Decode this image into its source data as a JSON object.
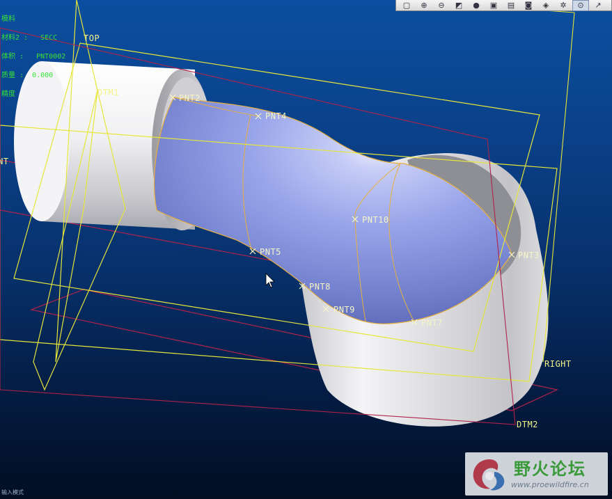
{
  "app": {
    "name": "Pro/ENGINEER Wildfire",
    "view": "3D model view"
  },
  "toolbar": {
    "buttons": [
      {
        "name": "refit-icon",
        "glyph": "▢"
      },
      {
        "name": "zoom-in-icon",
        "glyph": "⊕"
      },
      {
        "name": "zoom-out-icon",
        "glyph": "⊖"
      },
      {
        "name": "repaint-icon",
        "glyph": "◩"
      },
      {
        "name": "shading-icon",
        "glyph": "●"
      },
      {
        "name": "saved-views-icon",
        "glyph": "▣"
      },
      {
        "name": "view-manager-icon",
        "glyph": "▤"
      },
      {
        "name": "screenshot-icon",
        "glyph": "◙"
      },
      {
        "name": "orient-icon",
        "glyph": "◈"
      },
      {
        "name": "spin-center-icon",
        "glyph": "✲"
      },
      {
        "name": "datum-display-icon",
        "glyph": "⊙"
      },
      {
        "name": "extra-tool-icon",
        "glyph": "↗"
      }
    ]
  },
  "info_panel": {
    "lines": [
      "模料",
      "材料2 :   SECC",
      "体积 :   PNT0002",
      "质量 :  0.000",
      "精度"
    ]
  },
  "datum_planes": {
    "top": "TOP",
    "dtm1": "DTM1",
    "right": "RIGHT",
    "dtm2": "DTM2",
    "front": "FRONT"
  },
  "datum_points": {
    "pnt2": "PNT2",
    "pnt3": "PNT3",
    "pnt4": "PNT4",
    "pnt5": "PNT5",
    "pnt7": "PNT7",
    "pnt8": "PNT8",
    "pnt9": "PNT9",
    "pnt10": "PNT10"
  },
  "status_line": "输入模式",
  "watermark": {
    "title": "野火论坛",
    "url": "www.proewildfire.cn"
  },
  "colors": {
    "background_top": "#0b4fa0",
    "background_bottom": "#020d22",
    "datum_plane_yellow": "#e6e63a",
    "datum_plane_red": "#b0234a",
    "surface_blue": "#8f9fe6",
    "solid_white": "#e8e8ea",
    "edge_orange": "#e8b040",
    "info_green": "#38e038"
  }
}
